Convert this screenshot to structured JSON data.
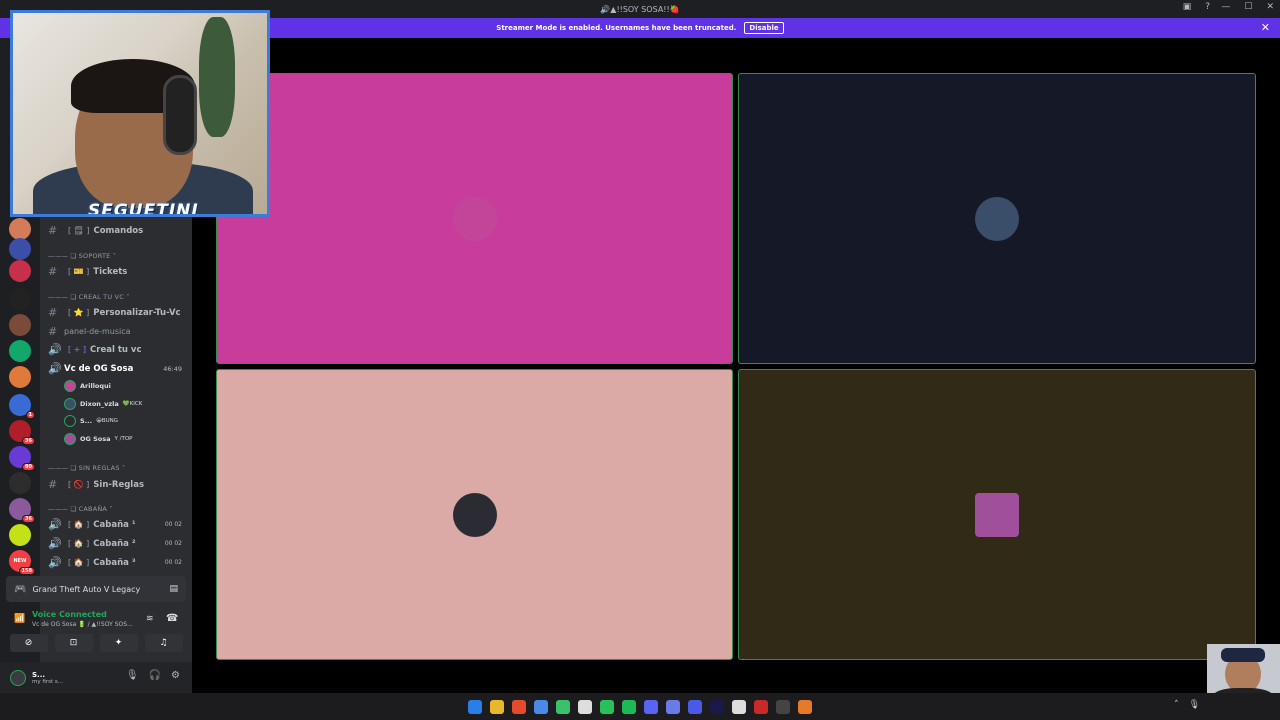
{
  "window": {
    "title": "🔊▲!!SOY SOSA!!🍓"
  },
  "banner": {
    "text": "Streamer Mode is enabled. Usernames have been truncated.",
    "button": "Disable"
  },
  "webcam": {
    "overlay_text": "SEGUETINI"
  },
  "rail": [
    {
      "color": "#d47b5a",
      "badge": ""
    },
    {
      "color": "#3b4ea8",
      "badge": ""
    },
    {
      "color": "#c7304a",
      "badge": ""
    },
    {
      "color": "#222222",
      "badge": ""
    },
    {
      "color": "#7a4a3a",
      "badge": ""
    },
    {
      "color": "#12a86b",
      "badge": ""
    },
    {
      "color": "#e07a3a",
      "badge": ""
    },
    {
      "color": "#3a6ad4",
      "badge": "1"
    },
    {
      "color": "#b01e2a",
      "badge": "36"
    },
    {
      "color": "#6a3ad4",
      "badge": "80"
    },
    {
      "color": "#2d2d2d",
      "badge": ""
    },
    {
      "color": "#8a5a9a",
      "badge": "36"
    },
    {
      "color": "#c4e017",
      "badge": ""
    },
    {
      "color": "#f23f43",
      "badge": "158",
      "label": "NEW"
    }
  ],
  "channels": {
    "comandos": "Comandos",
    "cat_soporte": "SOPORTE",
    "tickets": "Tickets",
    "cat_creal": "CREAL TU VC",
    "personalizar": "Personalizar-Tu-Vc",
    "panel": "panel-de-musica",
    "creal": "Creal tu vc",
    "voice_channel": "Vc de OG Sosa",
    "voice_timer": "46:49",
    "users": [
      {
        "name": "Arilloqui",
        "tag": ""
      },
      {
        "name": "Dixon_vzla",
        "tag": "💚KICK"
      },
      {
        "name": "S...",
        "tag": "😀BUNG"
      },
      {
        "name": "OG Sosa",
        "tag": "Y /TOP"
      }
    ],
    "cat_sinreglas": "SIN REGLAS",
    "sinreglas": "Sin-Reglas",
    "cat_cabana": "CABAÑA",
    "cabanas": [
      {
        "name": "Cabaña ¹",
        "count": "00 02"
      },
      {
        "name": "Cabaña ²",
        "count": "00 02"
      },
      {
        "name": "Cabaña ³",
        "count": "00 02"
      }
    ]
  },
  "activity": {
    "game": "Grand Theft Auto V Legacy"
  },
  "voice": {
    "status": "Voice Connected",
    "channel": "Vc de OG Sosa 🔋 / ▲!!SOY SOS..."
  },
  "user": {
    "name": "S...",
    "status": "my first s..."
  },
  "tiles": [
    {
      "bg": "#c83c9c",
      "ava": "#c2459a"
    },
    {
      "bg": "#151827",
      "ava": "#3a4e6a"
    },
    {
      "bg": "#dcaaa6",
      "ava": "#2b2b33"
    },
    {
      "bg": "#302a17",
      "ava": "#a0509a"
    }
  ],
  "taskbar": {
    "icons": [
      "windows-icon",
      "folder-icon",
      "brave-icon",
      "chrome-icon",
      "chrome-icon",
      "chatgpt-icon",
      "whatsapp-icon",
      "spotify-icon",
      "discord-icon",
      "files-icon",
      "calendar-icon",
      "premiere-icon",
      "capcut-icon",
      "obs-icon",
      "notes-icon",
      "app-icon"
    ],
    "colors": [
      "#2a7fe6",
      "#e6b82a",
      "#e24c2c",
      "#4a8ae6",
      "#3ac26a",
      "#dddddd",
      "#29c05a",
      "#1db954",
      "#5865f2",
      "#6a7ae6",
      "#4a5ae6",
      "#1a1a4a",
      "#dddddd",
      "#c82a2a",
      "#444444",
      "#e67a2a"
    ]
  }
}
